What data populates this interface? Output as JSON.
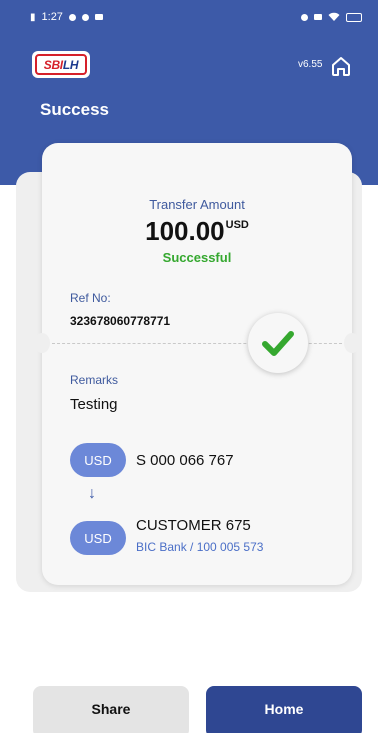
{
  "status_bar": {
    "time": "1:27"
  },
  "app": {
    "logo_text_part1": "SBI",
    "logo_text_part2": "LH",
    "version": "v6.55",
    "page_title": "Success"
  },
  "transfer": {
    "amount_label": "Transfer Amount",
    "amount": "100.00",
    "currency": "USD",
    "status": "Successful"
  },
  "reference": {
    "label": "Ref No:",
    "value": "323678060778771"
  },
  "remarks": {
    "label": "Remarks",
    "value": "Testing"
  },
  "from_account": {
    "currency": "USD",
    "account": "S 000 066 767"
  },
  "arrow_glyph": "↓",
  "to_account": {
    "currency": "USD",
    "name": "CUSTOMER 675",
    "detail": "BIC Bank / 100 005 573"
  },
  "buttons": {
    "share": "Share",
    "home": "Home"
  },
  "colors": {
    "header": "#3d5aa8",
    "success": "#35a82f",
    "pill": "#6c88d8",
    "primary_button": "#2f4792"
  },
  "icons": [
    "signal-icon",
    "whatsapp-icon",
    "messenger-icon",
    "message-icon",
    "alarm-icon",
    "sim-icon",
    "wifi-icon",
    "battery-icon",
    "home-icon",
    "checkmark-icon",
    "arrow-down-icon"
  ]
}
